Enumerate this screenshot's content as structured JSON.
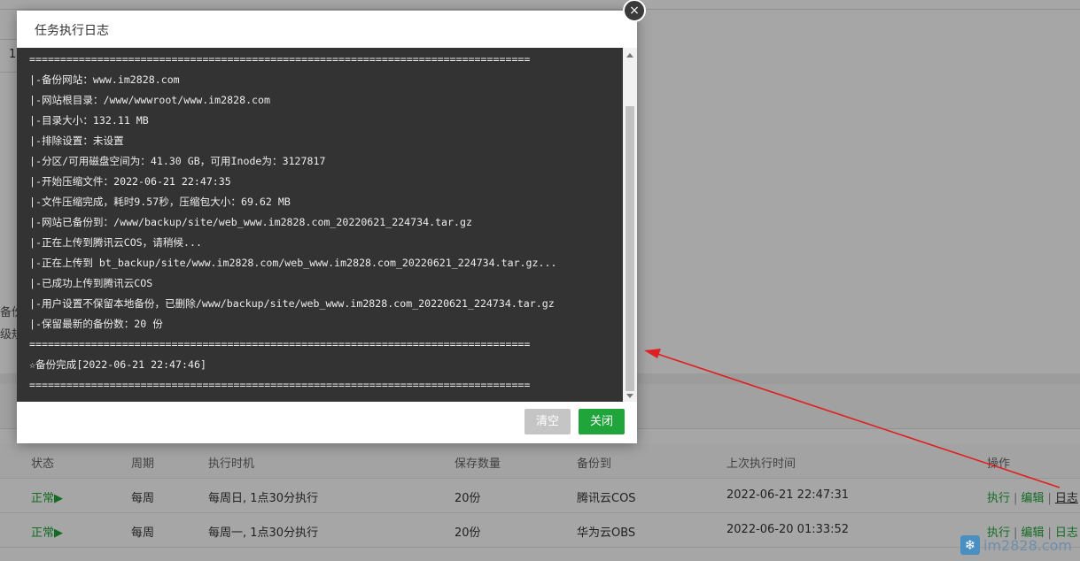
{
  "dialog": {
    "title": "任务执行日志",
    "close_icon": "×",
    "log_lines": [
      "=================================================================================",
      "|-备份网站：www.im2828.com",
      "|-网站根目录：/www/wwwroot/www.im2828.com",
      "|-目录大小：132.11 MB",
      "|-排除设置：未设置",
      "|-分区/可用磁盘空间为：41.30 GB，可用Inode为：3127817",
      "|-开始压缩文件：2022-06-21 22:47:35",
      "|-文件压缩完成，耗时9.57秒，压缩包大小：69.62 MB",
      "|-网站已备份到：/www/backup/site/web_www.im2828.com_20220621_224734.tar.gz",
      "|-正在上传到腾讯云COS，请稍候...",
      "|-正在上传到 bt_backup/site/www.im2828.com/web_www.im2828.com_20220621_224734.tar.gz...",
      "|-已成功上传到腾讯云COS",
      "|-用户设置不保留本地备份，已删除/www/backup/site/web_www.im2828.com_20220621_224734.tar.gz",
      "|-保留最新的备份数：20 份",
      "=================================================================================",
      "☆备份完成[2022-06-21 22:47:46]",
      "================================================================================="
    ],
    "clear_label": "清空",
    "close_label": "关闭"
  },
  "background": {
    "left_mark": "1",
    "side_text_1": "备份",
    "side_text_2": "级规",
    "table": {
      "headers": [
        "状态",
        "周期",
        "执行时机",
        "保存数量",
        "备份到",
        "上次执行时间",
        "操作"
      ],
      "rows": [
        {
          "status": "正常▶",
          "cycle": "每周",
          "timing": "每周日, 1点30分执行",
          "count": "20份",
          "target": "腾讯云COS",
          "last_run": "2022-06-21 22:47:31",
          "ops": [
            "执行",
            "编辑",
            "日志"
          ]
        },
        {
          "status": "正常▶",
          "cycle": "每周",
          "timing": "每周一, 1点30分执行",
          "count": "20份",
          "target": "华为云OBS",
          "last_run": "2022-06-20 01:33:52",
          "ops": [
            "执行",
            "编辑",
            "日志"
          ]
        }
      ]
    }
  },
  "watermark": {
    "logo_icon": "snowflake-icon",
    "text": "im2828.com"
  },
  "colors": {
    "accent": "#20a53a",
    "log_bg": "#333333",
    "annotation_arrow": "#e02020"
  }
}
